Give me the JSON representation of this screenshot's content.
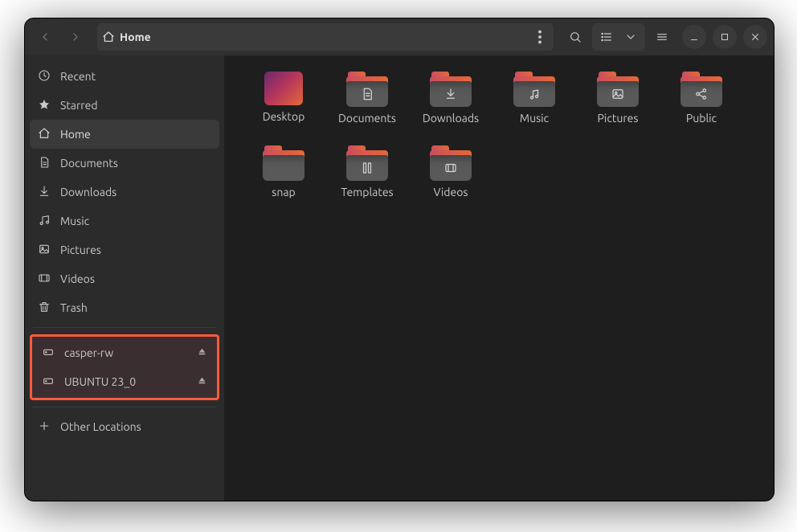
{
  "header": {
    "path_label": "Home"
  },
  "sidebar": {
    "items": [
      {
        "id": "recent",
        "label": "Recent",
        "icon": "clock"
      },
      {
        "id": "starred",
        "label": "Starred",
        "icon": "star"
      },
      {
        "id": "home",
        "label": "Home",
        "icon": "home",
        "selected": true
      },
      {
        "id": "documents",
        "label": "Documents",
        "icon": "document"
      },
      {
        "id": "downloads",
        "label": "Downloads",
        "icon": "download"
      },
      {
        "id": "music",
        "label": "Music",
        "icon": "music"
      },
      {
        "id": "pictures",
        "label": "Pictures",
        "icon": "picture"
      },
      {
        "id": "videos",
        "label": "Videos",
        "icon": "video"
      },
      {
        "id": "trash",
        "label": "Trash",
        "icon": "trash"
      }
    ],
    "mounts": [
      {
        "id": "casper",
        "label": "casper-rw",
        "icon": "drive",
        "ejectable": true
      },
      {
        "id": "ubuntu",
        "label": "UBUNTU 23_0",
        "icon": "drive",
        "ejectable": true
      }
    ],
    "other_locations_label": "Other Locations",
    "mounts_highlighted": true
  },
  "files": [
    {
      "label": "Desktop",
      "kind": "desktop"
    },
    {
      "label": "Documents",
      "kind": "folder",
      "glyph": "document"
    },
    {
      "label": "Downloads",
      "kind": "folder",
      "glyph": "download"
    },
    {
      "label": "Music",
      "kind": "folder",
      "glyph": "music"
    },
    {
      "label": "Pictures",
      "kind": "folder",
      "glyph": "picture"
    },
    {
      "label": "Public",
      "kind": "folder",
      "glyph": "share"
    },
    {
      "label": "snap",
      "kind": "folder",
      "glyph": ""
    },
    {
      "label": "Templates",
      "kind": "folder",
      "glyph": "template"
    },
    {
      "label": "Videos",
      "kind": "folder",
      "glyph": "video"
    }
  ]
}
